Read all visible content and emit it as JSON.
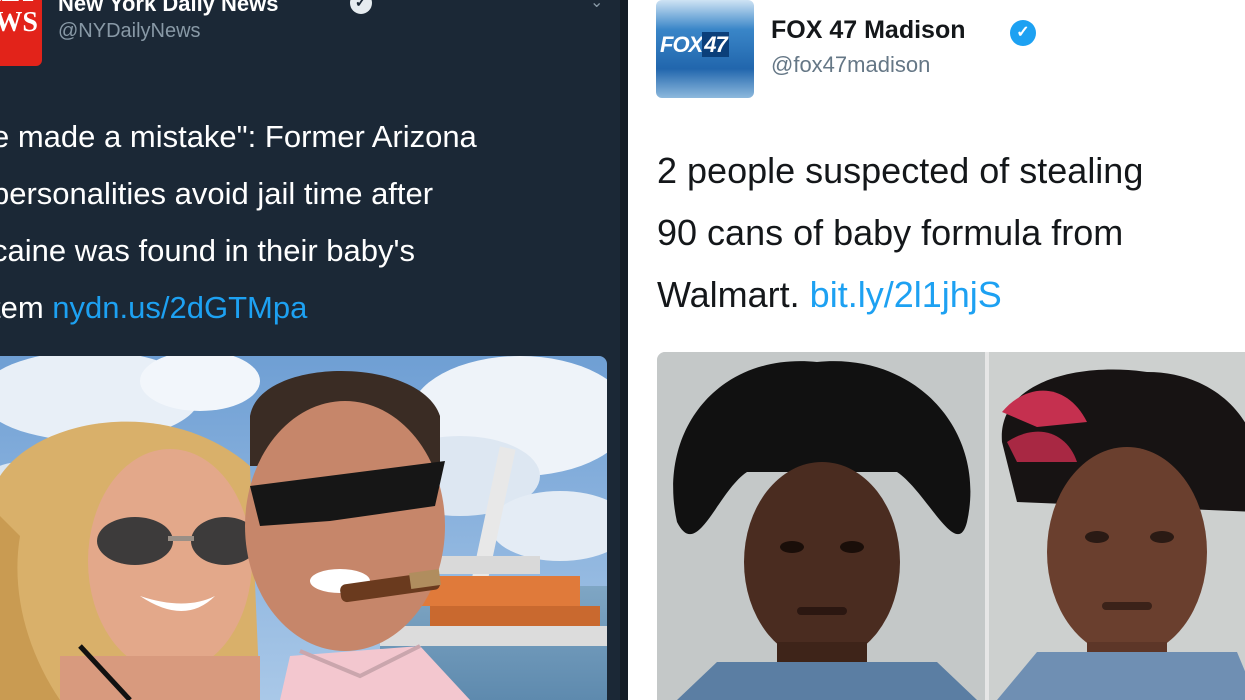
{
  "left_tweet": {
    "avatar_text": [
      "ILY",
      "WS"
    ],
    "name": "New York Daily News",
    "handle": "@NYDailyNews",
    "lines": [
      "e made a mistake\": Former Arizona",
      " personalities avoid jail time after",
      "caine was found in their baby's"
    ],
    "last_line_text": "tem ",
    "link": "nydn.us/2dGTMpa",
    "colors": {
      "background": "#1b2836",
      "link": "#1da1f2"
    },
    "icons": [
      "verified-icon",
      "chevron-down-icon"
    ]
  },
  "right_tweet": {
    "avatar_logo": "FOX",
    "avatar_logo_num": "47",
    "name": "FOX 47 Madison",
    "handle": "@fox47madison",
    "lines": [
      "2 people suspected of stealing",
      "90 cans of baby formula from"
    ],
    "last_line_text": "Walmart. ",
    "link": "bit.ly/2l1jhjS",
    "colors": {
      "background": "#ffffff",
      "link": "#1da1f2",
      "verified": "#1da1f2"
    },
    "icons": [
      "verified-icon"
    ]
  }
}
